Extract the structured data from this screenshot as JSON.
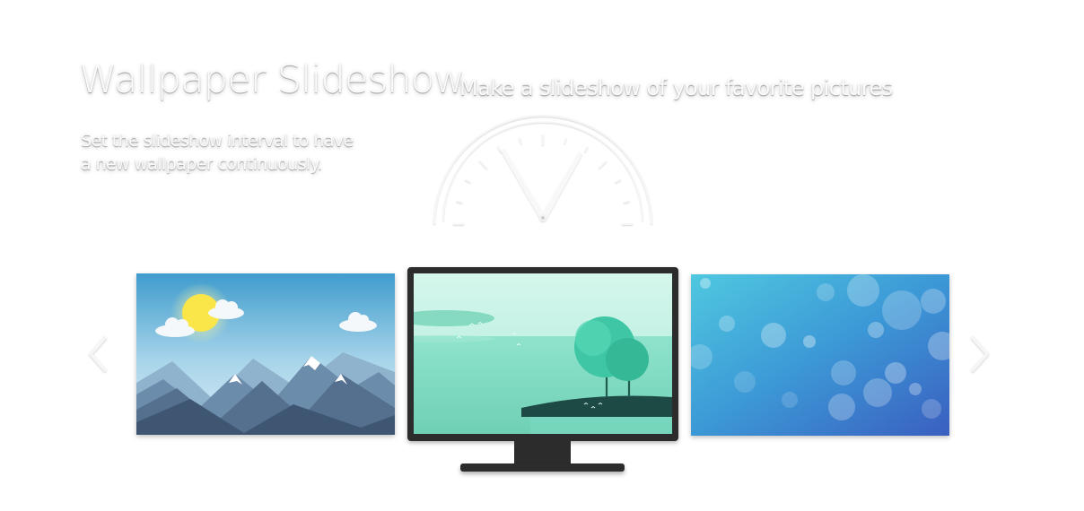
{
  "header": {
    "title": "Wallpaper Slideshow",
    "subtitle": "Make a slideshow of your favorite pictures"
  },
  "description": {
    "line1": "Set the slideshow interval to have",
    "line2": "a new wallpaper continuously."
  },
  "carousel": {
    "prev_icon": "chevron-left-icon",
    "next_icon": "chevron-right-icon",
    "slides": [
      {
        "scene": "mountains-sun-clouds",
        "position": "left"
      },
      {
        "scene": "teal-lake-trees",
        "position": "center-monitor",
        "selected": true
      },
      {
        "scene": "blue-bokeh",
        "position": "right"
      }
    ]
  },
  "colors": {
    "monitor": "#2c2c2c",
    "text": "#fafafa",
    "background": "#ffffff"
  }
}
